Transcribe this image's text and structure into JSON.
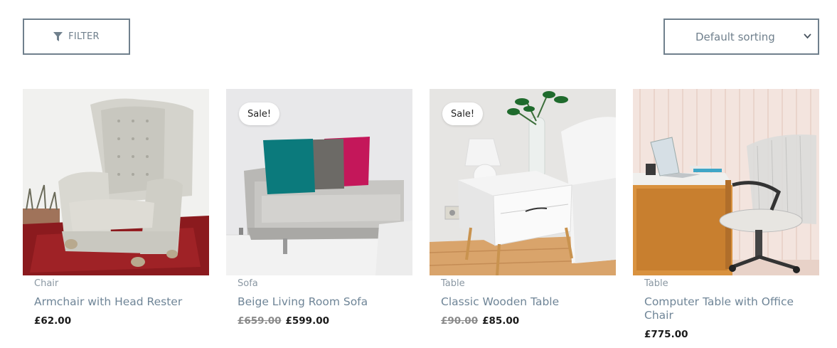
{
  "toolbar": {
    "filter_label": "FILTER",
    "sort_selected": "Default sorting"
  },
  "products": [
    {
      "category": "Chair",
      "title": "Armchair with Head Rester",
      "price": "£62.00",
      "old_price": "",
      "badge": ""
    },
    {
      "category": "Sofa",
      "title": "Beige Living Room Sofa",
      "price": "£599.00",
      "old_price": "£659.00",
      "badge": "Sale!"
    },
    {
      "category": "Table",
      "title": "Classic Wooden Table",
      "price": "£85.00",
      "old_price": "£90.00",
      "badge": "Sale!"
    },
    {
      "category": "Table",
      "title": "Computer Table with Office Chair",
      "price": "£775.00",
      "old_price": "",
      "badge": ""
    }
  ],
  "icons": {
    "filter": "filter-icon",
    "sort": "chevron-down-icon"
  }
}
